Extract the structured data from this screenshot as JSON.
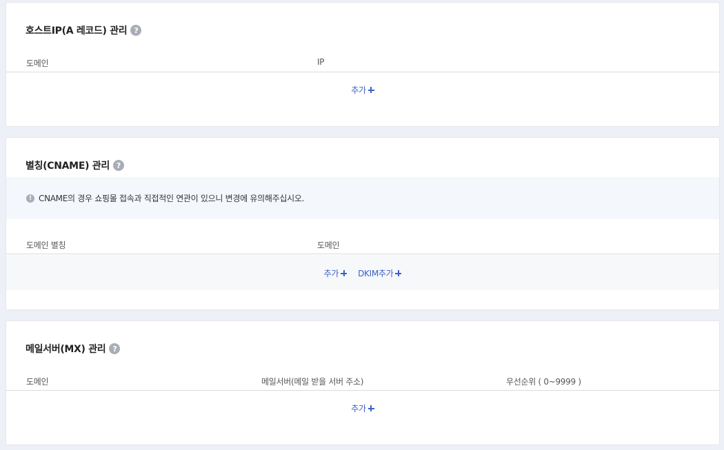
{
  "a_record": {
    "title": "호스트IP(A 레코드) 관리",
    "help": "?",
    "headers": [
      "도메인",
      "IP"
    ],
    "add_label": "추가"
  },
  "cname": {
    "title": "별칭(CNAME) 관리",
    "help": "?",
    "notice_icon": "!",
    "notice": "CNAME의 경우 쇼핑몰 접속과 직접적인 연관이 있으니 변경에 유의해주십시오.",
    "headers": [
      "도메인 별칭",
      "도메인"
    ],
    "add_label": "추가",
    "dkim_add_label": "DKIM추가"
  },
  "mx": {
    "title": "메일서버(MX) 관리",
    "help": "?",
    "headers": [
      "도메인",
      "메일서버(메일 받을 서버 주소)",
      "우선순위 ( 0~9999 )"
    ],
    "add_label": "추가"
  },
  "colors": {
    "accent": "#3a5fc8",
    "background": "#edf0f6",
    "notice_bg": "#f4f7fc"
  }
}
